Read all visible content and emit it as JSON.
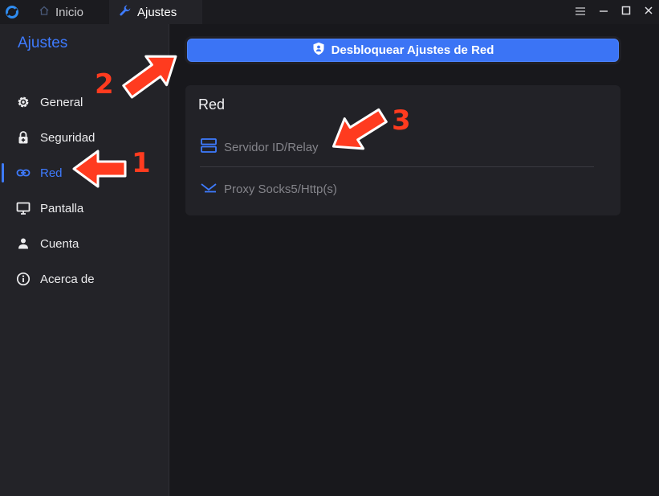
{
  "titlebar": {
    "tabs": [
      {
        "label": "Inicio",
        "icon": "home-icon"
      },
      {
        "label": "Ajustes",
        "icon": "wrench-icon"
      }
    ],
    "controls": [
      "menu-icon",
      "minimize-icon",
      "maximize-icon",
      "close-icon"
    ]
  },
  "sidebar": {
    "title": "Ajustes",
    "items": [
      {
        "label": "General",
        "icon": "gear-icon",
        "active": false
      },
      {
        "label": "Seguridad",
        "icon": "lock-icon",
        "active": false
      },
      {
        "label": "Red",
        "icon": "link-icon",
        "active": true
      },
      {
        "label": "Pantalla",
        "icon": "monitor-icon",
        "active": false
      },
      {
        "label": "Cuenta",
        "icon": "person-icon",
        "active": false
      },
      {
        "label": "Acerca de",
        "icon": "info-icon",
        "active": false
      }
    ]
  },
  "main": {
    "unlock_button": {
      "label": "Desbloquear Ajustes de Red",
      "icon": "shield-icon"
    },
    "panel": {
      "title": "Red",
      "rows": [
        {
          "label": "Servidor ID/Relay",
          "icon": "server-icon"
        },
        {
          "label": "Proxy Socks5/Http(s)",
          "icon": "proxy-icon"
        }
      ]
    }
  },
  "annotations": {
    "numbers": [
      "1",
      "2",
      "3"
    ]
  },
  "colors": {
    "accent": "#3e7bff",
    "button": "#3b74f5",
    "arrow": "#ff3b1f",
    "background": "#18181c",
    "sidebar": "#232328"
  }
}
